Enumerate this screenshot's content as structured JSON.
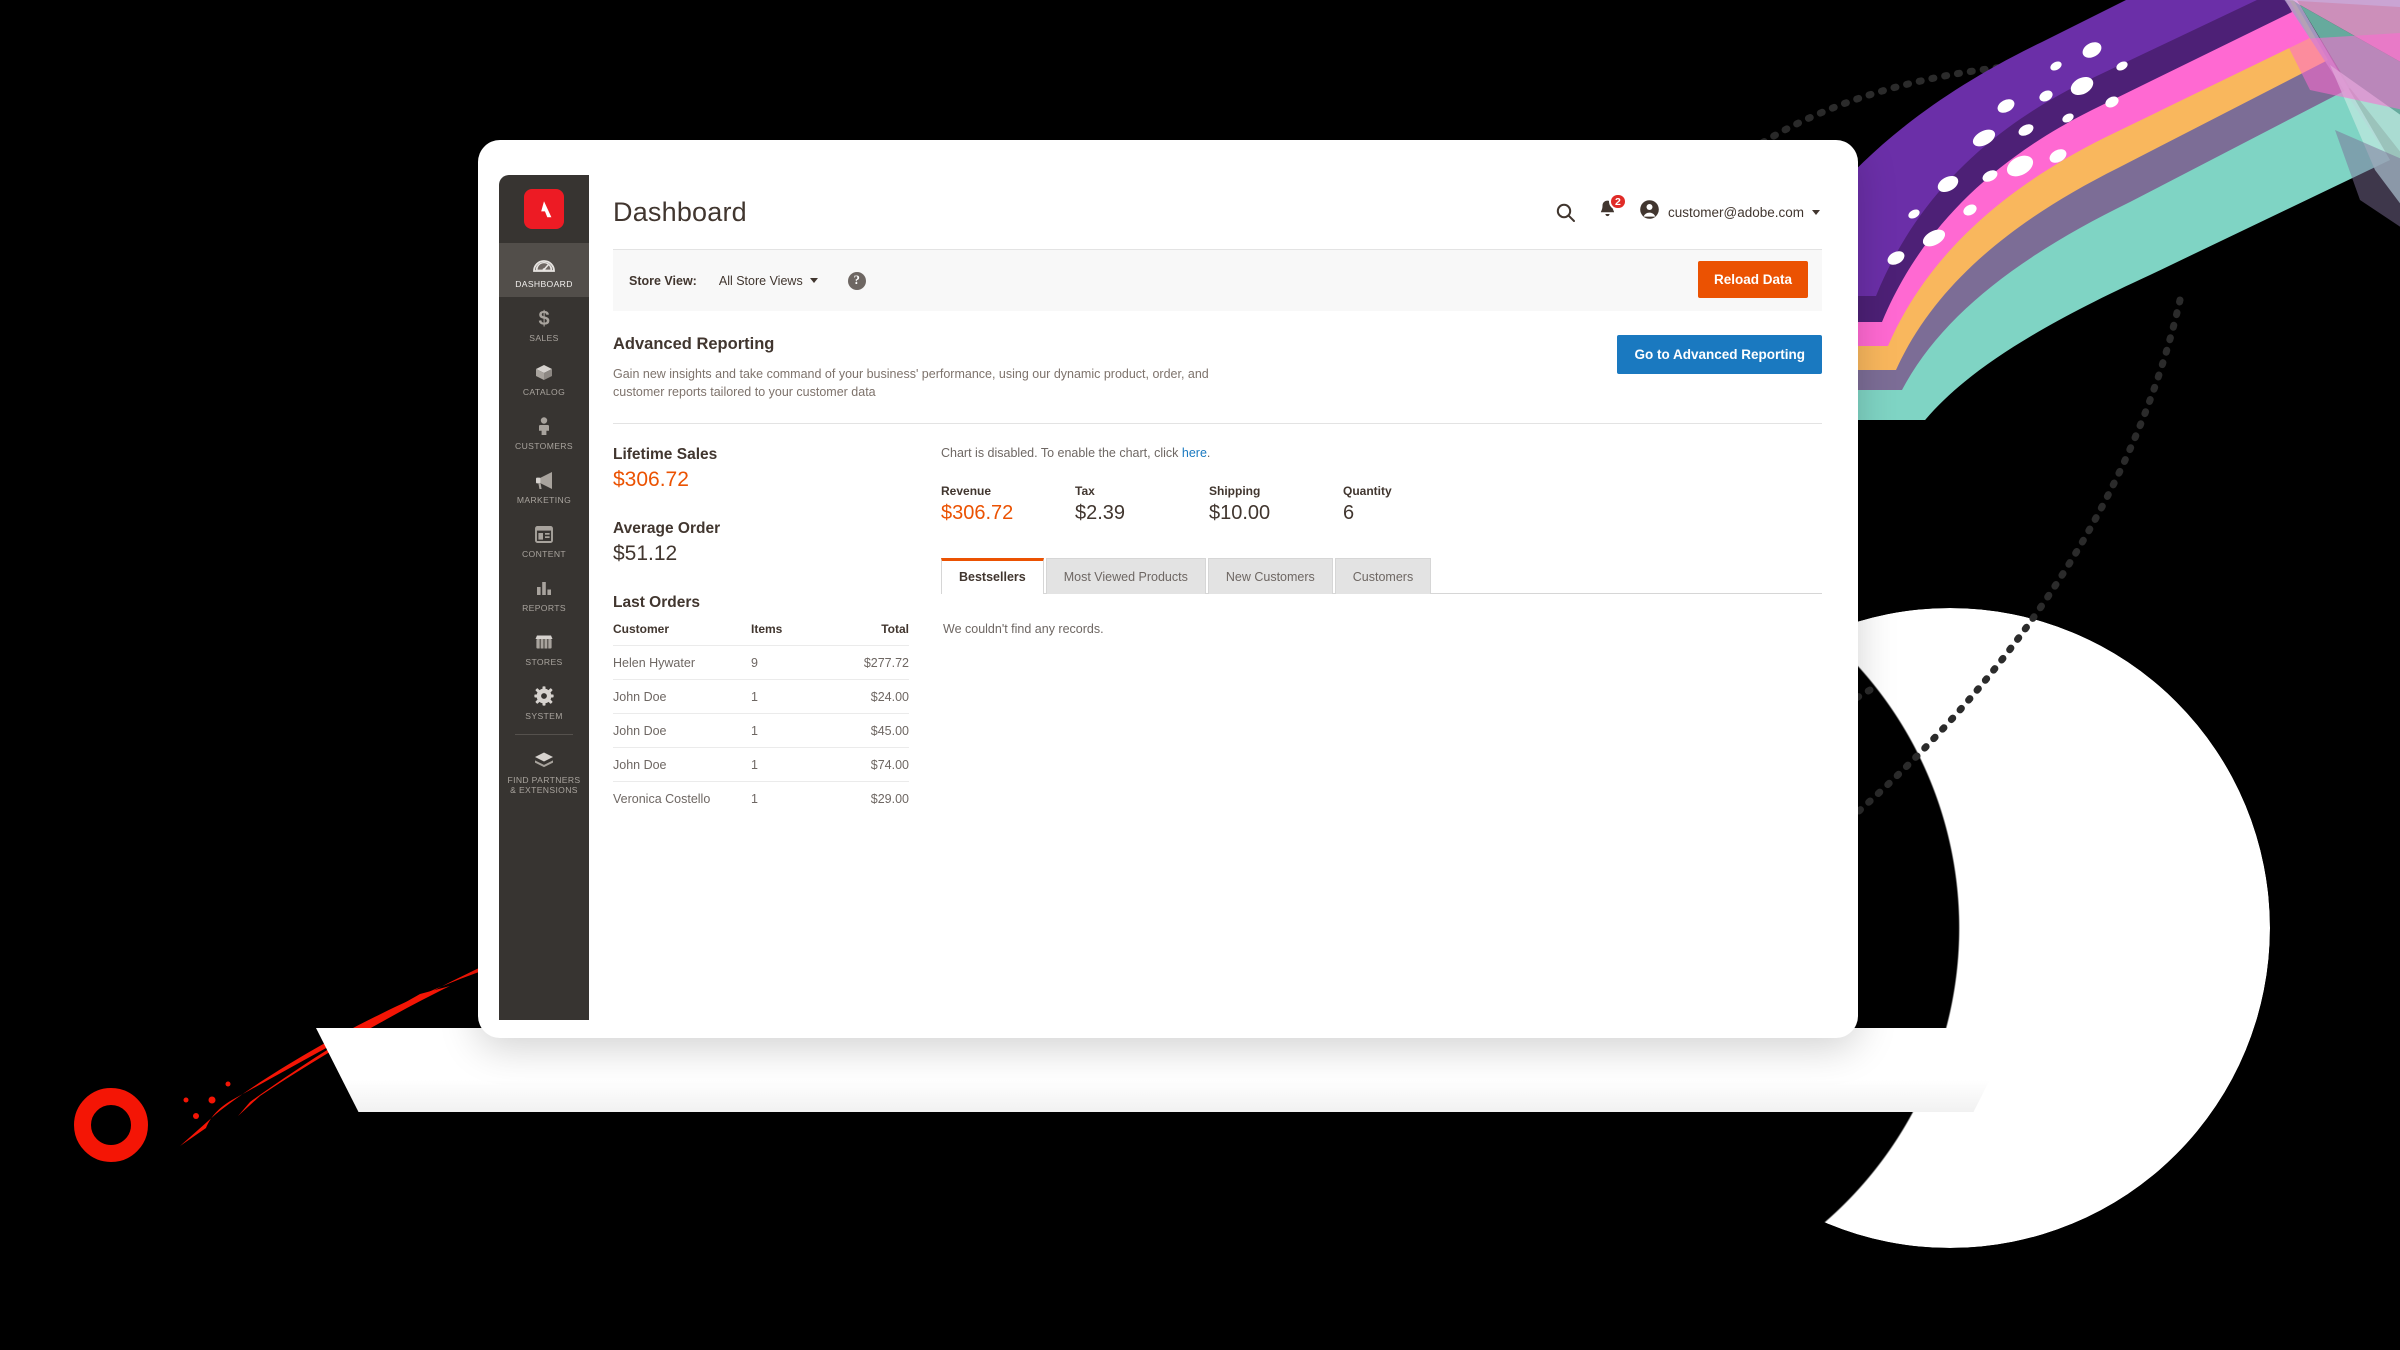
{
  "app": {
    "logo_icon": "adobe-logo-icon",
    "page_title": "Dashboard"
  },
  "sidebar": {
    "items": [
      {
        "label": "DASHBOARD",
        "icon": "gauge-icon",
        "active": true
      },
      {
        "label": "SALES",
        "icon": "dollar-icon",
        "active": false
      },
      {
        "label": "CATALOG",
        "icon": "box-icon",
        "active": false
      },
      {
        "label": "CUSTOMERS",
        "icon": "person-icon",
        "active": false
      },
      {
        "label": "MARKETING",
        "icon": "megaphone-icon",
        "active": false
      },
      {
        "label": "CONTENT",
        "icon": "layout-icon",
        "active": false
      },
      {
        "label": "REPORTS",
        "icon": "bar-chart-icon",
        "active": false
      },
      {
        "label": "STORES",
        "icon": "storefront-icon",
        "active": false
      },
      {
        "label": "SYSTEM",
        "icon": "gear-icon",
        "active": false
      },
      {
        "label": "FIND PARTNERS\n& EXTENSIONS",
        "icon": "extension-box-icon",
        "active": false
      }
    ]
  },
  "header": {
    "search_icon": "search-icon",
    "notifications_icon": "bell-icon",
    "notifications_count": "2",
    "account_icon": "user-avatar-icon",
    "account_email": "customer@adobe.com",
    "account_caret_icon": "chevron-down-icon"
  },
  "storeview": {
    "label": "Store View:",
    "selected": "All Store Views",
    "caret_icon": "chevron-down-icon",
    "help_icon": "question-mark-icon",
    "help_glyph": "?",
    "reload_label": "Reload Data"
  },
  "advanced_reporting": {
    "title": "Advanced Reporting",
    "description": "Gain new insights and take command of your business' performance, using our dynamic product, order, and customer reports tailored to your customer data",
    "button_label": "Go to Advanced Reporting"
  },
  "lifetime_sales": {
    "label": "Lifetime Sales",
    "value": "$306.72"
  },
  "average_order": {
    "label": "Average Order",
    "value": "$51.12"
  },
  "last_orders": {
    "title": "Last Orders",
    "columns": [
      "Customer",
      "Items",
      "Total"
    ],
    "rows": [
      {
        "customer": "Helen Hywater",
        "items": "9",
        "total": "$277.72"
      },
      {
        "customer": "John Doe",
        "items": "1",
        "total": "$24.00"
      },
      {
        "customer": "John Doe",
        "items": "1",
        "total": "$45.00"
      },
      {
        "customer": "John Doe",
        "items": "1",
        "total": "$74.00"
      },
      {
        "customer": "Veronica Costello",
        "items": "1",
        "total": "$29.00"
      }
    ]
  },
  "chart_notice": {
    "text_before": "Chart is disabled. To enable the chart, click ",
    "link_label": "here",
    "text_after": "."
  },
  "stats": [
    {
      "label": "Revenue",
      "value": "$306.72",
      "accent": true
    },
    {
      "label": "Tax",
      "value": "$2.39",
      "accent": false
    },
    {
      "label": "Shipping",
      "value": "$10.00",
      "accent": false
    },
    {
      "label": "Quantity",
      "value": "6",
      "accent": false
    }
  ],
  "tabs": {
    "items": [
      {
        "label": "Bestsellers",
        "active": true
      },
      {
        "label": "Most Viewed Products",
        "active": false
      },
      {
        "label": "New Customers",
        "active": false
      },
      {
        "label": "Customers",
        "active": false
      }
    ],
    "empty_message": "We couldn't find any records."
  },
  "colors": {
    "accent_orange": "#eb5202",
    "link_blue": "#1a79c0",
    "sidebar_bg": "#373431",
    "sidebar_active": "#524e4a",
    "adobe_red": "#ed1b24",
    "notification_red": "#e02b27",
    "comet_red": "#f41505",
    "ribbon_purple": "#6b2fa8",
    "ribbon_purple_dark": "#4d2076",
    "ribbon_mauve": "#7c6d96",
    "ribbon_pink": "#ff69d2",
    "ribbon_pink_light": "#ffb3e8",
    "ribbon_orange": "#f9b75d",
    "ribbon_teal": "#7fd4c4",
    "ribbon_teal_light": "#b6e5dc",
    "moon_white": "#ffffff"
  }
}
